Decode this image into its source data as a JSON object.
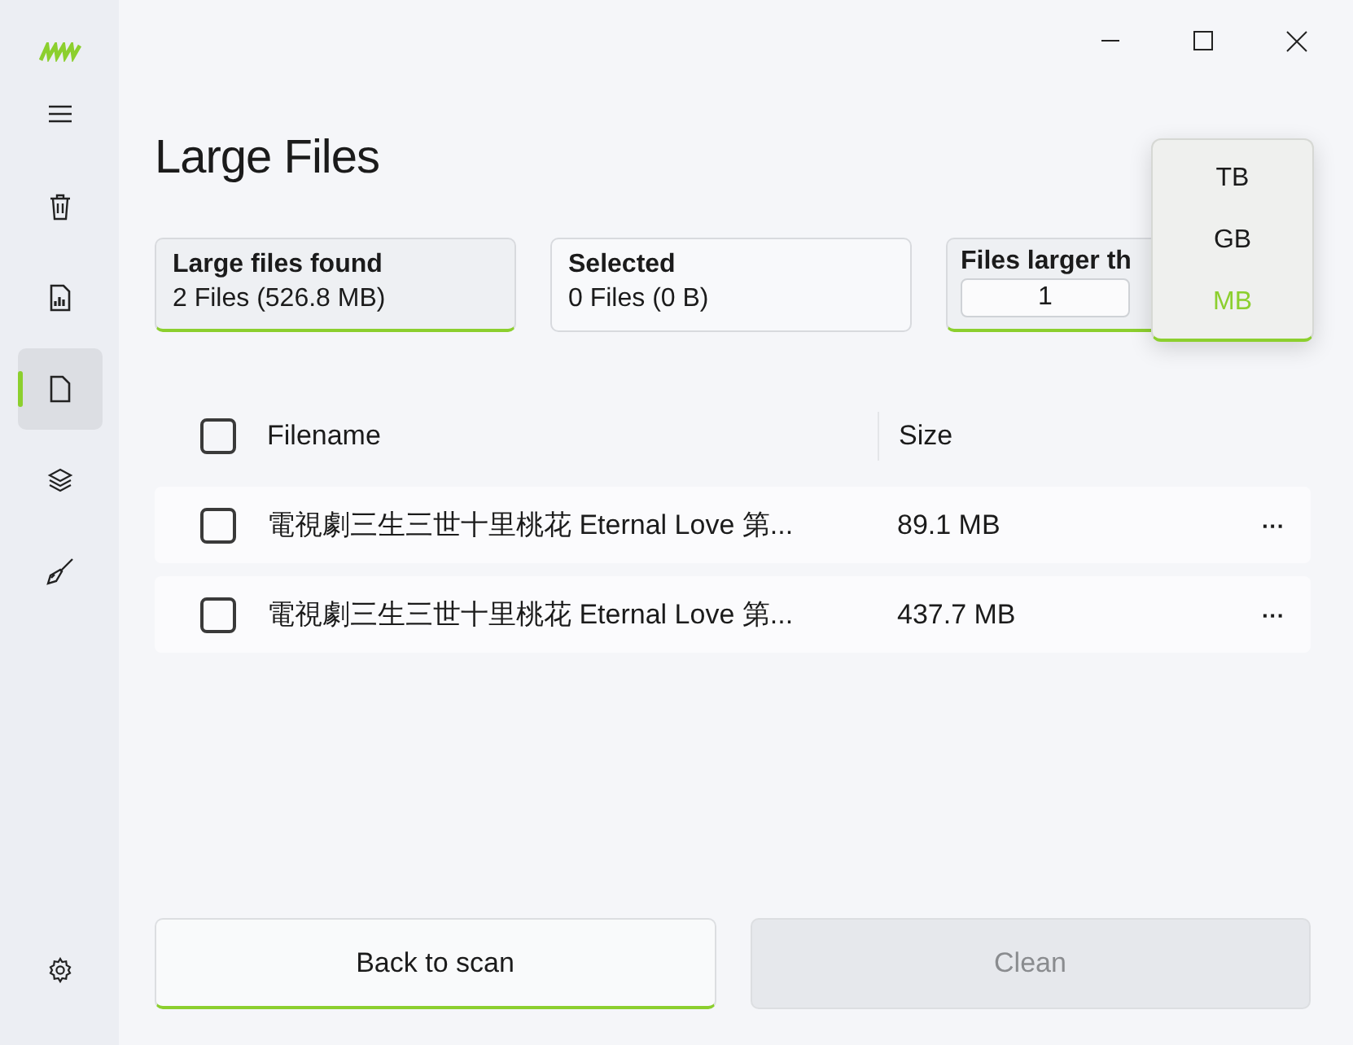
{
  "sidebar": {
    "items": [
      {
        "kind": "trash",
        "selected": false
      },
      {
        "kind": "report",
        "selected": false
      },
      {
        "kind": "file",
        "selected": true
      },
      {
        "kind": "layers",
        "selected": false
      },
      {
        "kind": "broom",
        "selected": false
      }
    ]
  },
  "title": "Large Files",
  "cards": [
    {
      "label": "Large files found",
      "value": "2 Files (526.8 MB)",
      "selected": true
    },
    {
      "label": "Selected",
      "value": "0 Files (0 B)",
      "selected": false
    }
  ],
  "size_filter": {
    "label": "Files larger th",
    "value": "1"
  },
  "unit_menu": [
    {
      "label": "TB",
      "selected": false
    },
    {
      "label": "GB",
      "selected": false
    },
    {
      "label": "MB",
      "selected": true
    }
  ],
  "table": {
    "header_checked": false,
    "columns": [
      "Filename",
      "Size"
    ],
    "rows": [
      {
        "checked": false,
        "filename": "電視劇三生三世十里桃花 Eternal Love 第...",
        "size": "89.1 MB",
        "more": "···"
      },
      {
        "checked": false,
        "filename": "電視劇三生三世十里桃花 Eternal Love 第...",
        "size": "437.7 MB",
        "more": "···"
      }
    ]
  },
  "buttons": [
    {
      "label": "Back to scan",
      "disabled": false
    },
    {
      "label": "Clean",
      "disabled": true
    }
  ]
}
